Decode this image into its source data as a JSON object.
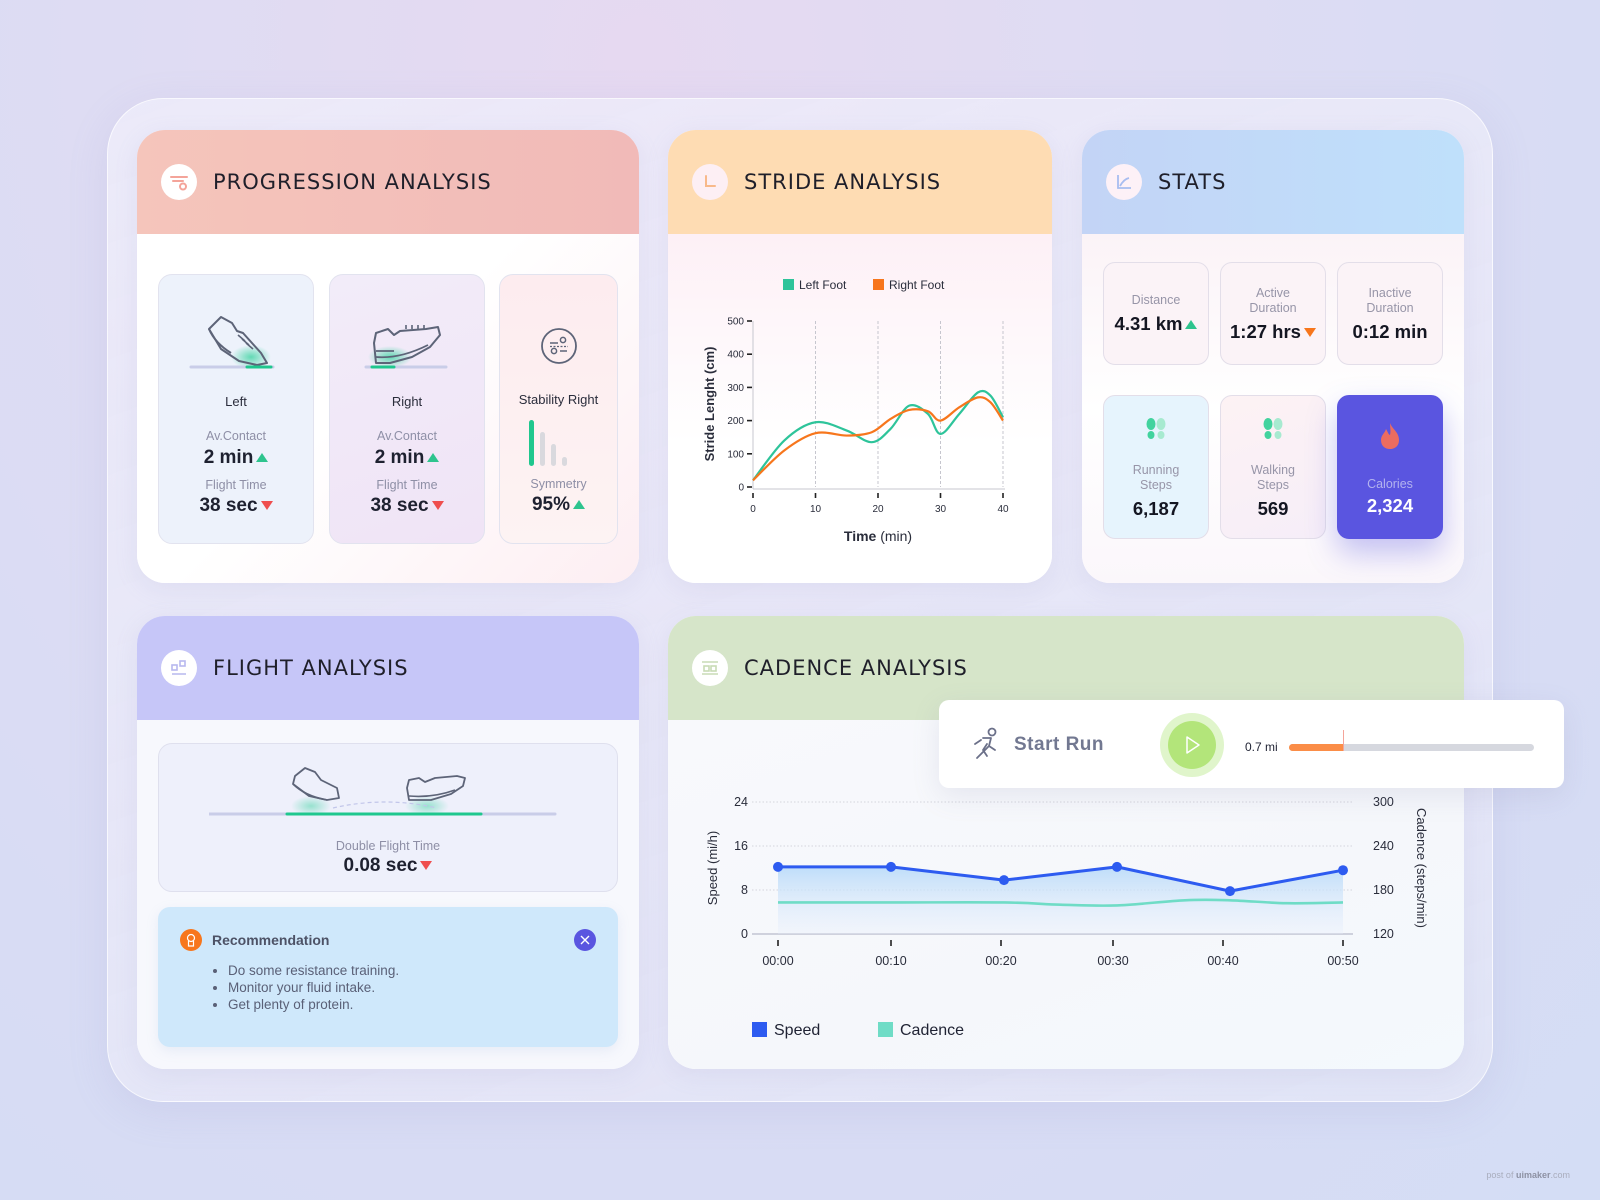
{
  "progression": {
    "title": "PROGRESSION ANALYSIS",
    "left": {
      "label": "Left",
      "contact_label": "Av.Contact",
      "contact_value": "2 min",
      "contact_trend": "up",
      "flight_label": "Flight Time",
      "flight_value": "38 sec",
      "flight_trend": "down"
    },
    "right": {
      "label": "Right",
      "contact_label": "Av.Contact",
      "contact_value": "2 min",
      "contact_trend": "up",
      "flight_label": "Flight Time",
      "flight_value": "38 sec",
      "flight_trend": "down"
    },
    "stability": {
      "label": "Stability Right",
      "symmetry_label": "Symmetry",
      "symmetry_value": "95%",
      "symmetry_trend": "up",
      "bar_levels": [
        1.0,
        0.74,
        0.47,
        0.2
      ]
    }
  },
  "stride": {
    "title": "STRIDE ANALYSIS",
    "chart_data": {
      "type": "line",
      "title": "",
      "xlabel_bold": "Time",
      "xlabel_unit": "(min)",
      "ylabel": "Stride Lenght (cm)",
      "x_ticks": [
        "0",
        "10",
        "20",
        "30",
        "40"
      ],
      "y_ticks": [
        "0",
        "100",
        "200",
        "300",
        "400",
        "500"
      ],
      "xlim": [
        0,
        40
      ],
      "ylim": [
        0,
        500
      ],
      "grid": "vertical-dashed",
      "legend_position": "top",
      "x": [
        0,
        5,
        10,
        15,
        19,
        22,
        25,
        28,
        30,
        33,
        36,
        38,
        40
      ],
      "series": [
        {
          "name": "Left Foot",
          "color": "#2ec49a",
          "values": [
            20,
            140,
            195,
            170,
            135,
            175,
            245,
            220,
            160,
            220,
            285,
            275,
            210
          ]
        },
        {
          "name": "Right Foot",
          "color": "#f7761c",
          "values": [
            20,
            110,
            162,
            155,
            165,
            205,
            232,
            228,
            200,
            240,
            270,
            255,
            200
          ]
        }
      ]
    }
  },
  "stats": {
    "title": "STATS",
    "distance": {
      "label": "Distance",
      "value": "4.31 km",
      "trend": "up"
    },
    "active": {
      "label": "Active Duration",
      "value": "1:27 hrs",
      "trend": "down"
    },
    "inactive": {
      "label": "Inactive Duration",
      "value": "0:12 min"
    },
    "running": {
      "label": "Running Steps",
      "value": "6,187"
    },
    "walking": {
      "label": "Walking Steps",
      "value": "569"
    },
    "calories": {
      "label": "Calories",
      "value": "2,324"
    },
    "colors": {
      "calories_bg": "#5a55e0",
      "up": "#2ec48e",
      "down_orange": "#f7761c"
    }
  },
  "flight": {
    "title": "FLIGHT ANALYSIS",
    "double_label": "Double Flight Time",
    "double_value": "0.08 sec",
    "double_trend": "down",
    "recommendation": {
      "title": "Recommendation",
      "items": [
        "Do some resistance training.",
        "Monitor your fluid intake.",
        "Get plenty of protein."
      ]
    }
  },
  "cadence": {
    "title": "CADENCE ANALYSIS",
    "chart_data": {
      "type": "line",
      "x_ticks": [
        "00:00",
        "00:10",
        "00:20",
        "00:30",
        "00:40",
        "00:50"
      ],
      "ylabel_left": "Speed (mi/h)",
      "ylabel_right": "Cadence (steps/min)",
      "y_left_ticks": [
        "0",
        "8",
        "16",
        "24"
      ],
      "y_right_ticks": [
        "120",
        "180",
        "240",
        "300"
      ],
      "ylim_left": [
        0,
        24
      ],
      "ylim_right": [
        120,
        300
      ],
      "grid": "horizontal-dotted",
      "legend_position": "bottom-left",
      "series": [
        {
          "name": "Speed",
          "axis": "left",
          "color": "#2d5bf0",
          "x": [
            0,
            10,
            20,
            30,
            40,
            50
          ],
          "values": [
            12.2,
            12.2,
            9.8,
            12.2,
            7.8,
            11.6
          ]
        },
        {
          "name": "Cadence",
          "axis": "right",
          "color": "#6fdcc6",
          "x": [
            0,
            10,
            20,
            25,
            30,
            36,
            40,
            45,
            50
          ],
          "values": [
            163,
            163,
            163,
            160,
            159,
            166,
            166,
            162,
            163
          ]
        }
      ]
    }
  },
  "run": {
    "label": "Start Run",
    "distance_label": "0.7 mi",
    "progress": 0.22
  },
  "watermark": {
    "prefix": "post of ",
    "brand": "uimaker",
    "suffix": ".com"
  }
}
